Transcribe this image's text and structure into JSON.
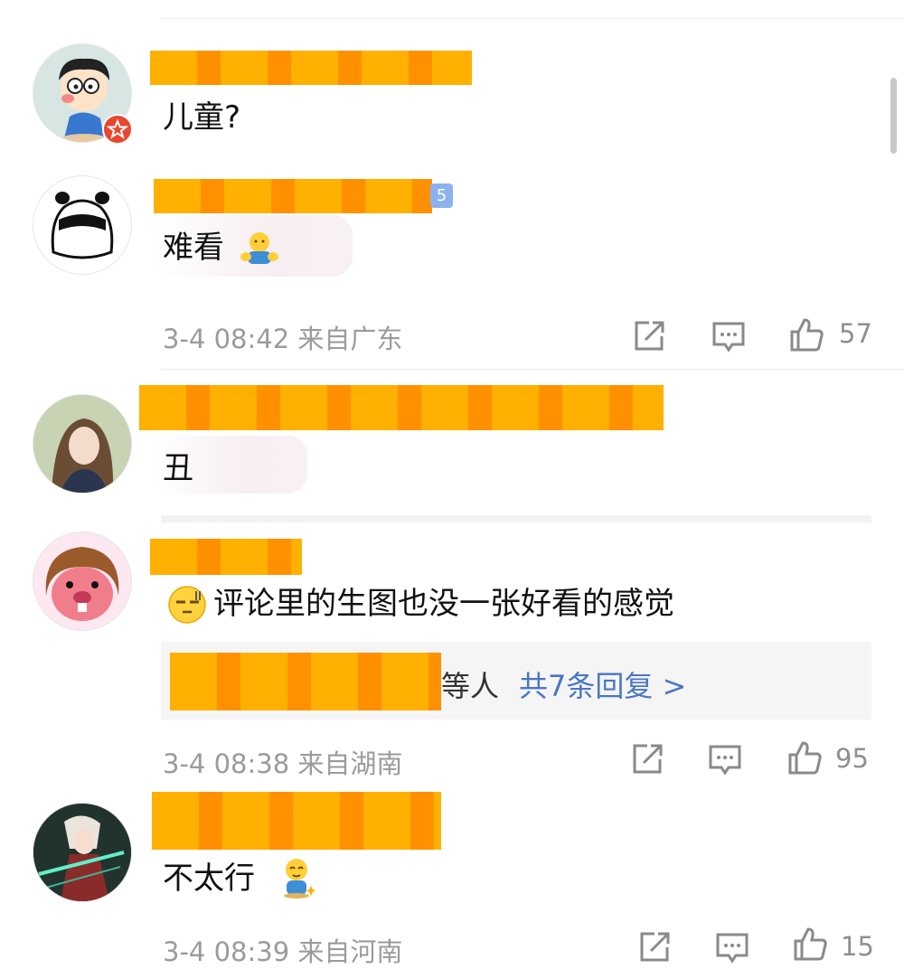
{
  "comments": [
    {
      "text": "儿童?"
    },
    {
      "text": "难看"
    },
    {
      "meta": "3-4 08:42  来自广东",
      "likes": "57"
    },
    {
      "text": "丑"
    },
    {
      "text": "评论里的生图也没一张好看的感觉",
      "reply_suffix": "等人",
      "reply_link": "共7条回复 >",
      "meta": "3-4 08:38  来自湖南",
      "likes": "95"
    },
    {
      "text": "不太行",
      "meta": "3-4 08:39  来自河南",
      "likes": "15"
    }
  ],
  "badge_text": "5",
  "colors": {
    "redaction": "#ffb000",
    "link": "#4a76c4",
    "meta": "#9b9b9b"
  }
}
